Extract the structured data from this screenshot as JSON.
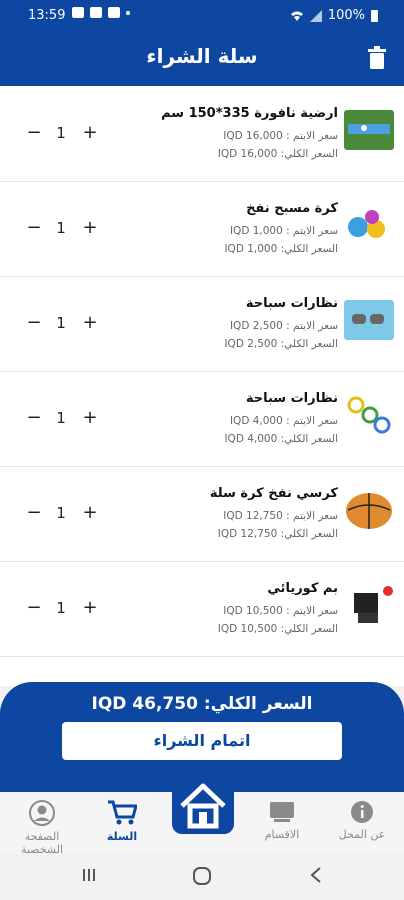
{
  "status": {
    "time": "13:59",
    "battery": "100%"
  },
  "header": {
    "title": "سلة الشراء",
    "icon": "trash-icon"
  },
  "cart": {
    "items": [
      {
        "name": "ارضية نافورة 335*150 سم",
        "unit_price": "سعر الايتم : IQD 16,000",
        "total_price": "السعر الكلي: IQD 16,000",
        "qty": "1",
        "image": "fountain-mat"
      },
      {
        "name": "كرة مسبح نفخ",
        "unit_price": "سعر الايتم : IQD 1,000",
        "total_price": "السعر الكلي: IQD 1,000",
        "qty": "1",
        "image": "beach-ball"
      },
      {
        "name": "نظارات سباحة",
        "unit_price": "سعر الايتم : IQD 2,500",
        "total_price": "السعر الكلي: IQD 2,500",
        "qty": "1",
        "image": "goggles"
      },
      {
        "name": "نظارات سباحة",
        "unit_price": "سعر الايتم : IQD 4,000",
        "total_price": "السعر الكلي: IQD 4,000",
        "qty": "1",
        "image": "goggles-set"
      },
      {
        "name": "كرسي نفخ كرة سلة",
        "unit_price": "سعر الايتم : IQD 12,750",
        "total_price": "السعر الكلي: IQD 12,750",
        "qty": "1",
        "image": "basketball-chair"
      },
      {
        "name": "بم كوريائي",
        "unit_price": "سعر الايتم : IQD 10,500",
        "total_price": "السعر الكلي: IQD 10,500",
        "qty": "1",
        "image": "pump"
      }
    ],
    "minus": "−",
    "plus": "+"
  },
  "footer": {
    "total": "السعر الكلي: IQD 46,750",
    "checkout_label": "اتمام الشراء"
  },
  "nav": {
    "items": [
      {
        "label": "عن المحل",
        "icon": "info-icon"
      },
      {
        "label": "الاقسام",
        "icon": "categories-icon"
      },
      {
        "label": "",
        "icon": "home-icon"
      },
      {
        "label": "السلة",
        "icon": "cart-icon"
      },
      {
        "label": "الصفحة الشخصية",
        "icon": "profile-icon"
      }
    ]
  },
  "colors": {
    "primary": "#0d47a1"
  }
}
